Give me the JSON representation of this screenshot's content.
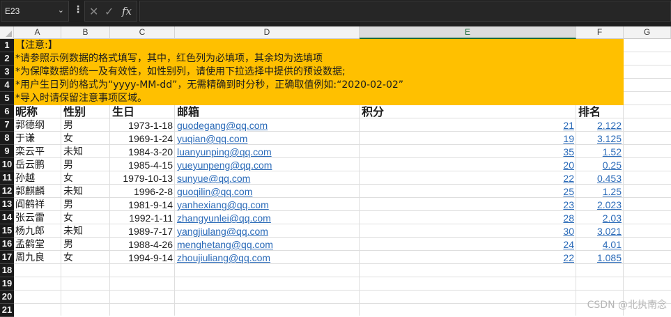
{
  "formula_bar": {
    "name_box": "E23",
    "name_box_chevron": "⌄",
    "more_dots": "⋮",
    "cancel_icon": "✕",
    "enter_icon": "✓",
    "fx_label": "fx",
    "formula": ""
  },
  "columns": [
    "A",
    "B",
    "C",
    "D",
    "E",
    "F",
    "G"
  ],
  "selected_column": "E",
  "rows": [
    "1",
    "2",
    "3",
    "4",
    "5",
    "6",
    "7",
    "8",
    "9",
    "10",
    "11",
    "12",
    "13",
    "14",
    "15",
    "16",
    "17",
    "18",
    "19",
    "20",
    "21"
  ],
  "notice_lines": [
    "【注意:】",
    "*请参照示例数据的格式填写，其中，红色列为必填项，其余均为选填项",
    "*为保障数据的统一及有效性，如性别列，请使用下拉选择中提供的预设数据;",
    "*用户生日列的格式为“yyyy-MM-dd”，无需精确到时分秒，正确取值例如:“2020-02-02”",
    "*导入时请保留注意事项区域。"
  ],
  "table": {
    "headers": [
      "昵称",
      "性别",
      "生日",
      "邮箱",
      "积分",
      "排名"
    ],
    "rows": [
      [
        "郭德纲",
        "男",
        "1973-1-18",
        "guodegang@qq.com",
        "21",
        "2.122"
      ],
      [
        "于谦",
        "女",
        "1969-1-24",
        "yuqian@qq.com",
        "19",
        "3.125"
      ],
      [
        "栾云平",
        "未知",
        "1984-3-20",
        "luanyunping@qq.com",
        "35",
        "1.52"
      ],
      [
        "岳云鹏",
        "男",
        "1985-4-15",
        "yueyunpeng@qq.com",
        "20",
        "0.25"
      ],
      [
        "孙越",
        "女",
        "1979-10-13",
        "sunyue@qq.com",
        "22",
        "0.453"
      ],
      [
        "郭麒麟",
        "未知",
        "1996-2-8",
        "guoqilin@qq.com",
        "25",
        "1.25"
      ],
      [
        "阎鹤祥",
        "男",
        "1981-9-14",
        "yanhexiang@qq.com",
        "23",
        "2.023"
      ],
      [
        "张云雷",
        "女",
        "1992-1-11",
        "zhangyunlei@qq.com",
        "28",
        "2.03"
      ],
      [
        "杨九郎",
        "未知",
        "1989-7-17",
        "yangjiulang@qq.com",
        "30",
        "3.021"
      ],
      [
        "孟鹤堂",
        "男",
        "1988-4-26",
        "menghetang@qq.com",
        "24",
        "4.01"
      ],
      [
        "周九良",
        "女",
        "1994-9-14",
        "zhoujiuliang@qq.com",
        "22",
        "1.085"
      ]
    ]
  },
  "watermark": "CSDN @北执南念",
  "colors": {
    "notice_fill": "#ffc000",
    "link": "#2a6ab8",
    "selection": "#1e6b3a"
  }
}
